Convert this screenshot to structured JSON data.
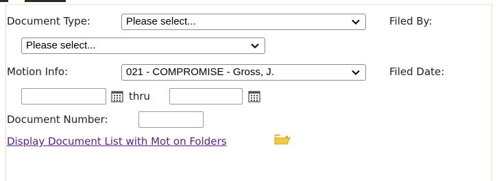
{
  "form": {
    "document_type_label": "Document Type:",
    "document_type_value": "Please select...",
    "filed_by_label": "Filed By:",
    "filed_by_value": "Please select...",
    "motion_info_label": "Motion Info:",
    "motion_info_value": "021 - COMPROMISE - Gross, J.",
    "filed_date_label": "Filed Date:",
    "date_from_value": "",
    "thru_label": "thru",
    "date_to_value": "",
    "document_number_label": "Document Number:",
    "document_number_value": "",
    "display_list_link": "Display Document List with Mot on Folders"
  },
  "icons": {
    "calendar": "calendar-icon",
    "folder": "folder-open-icon",
    "dropdown": "chevron-down-icon"
  },
  "colors": {
    "link": "#5b1e8e",
    "folder": "#f4c842",
    "panel_border": "#e8dcc0"
  }
}
